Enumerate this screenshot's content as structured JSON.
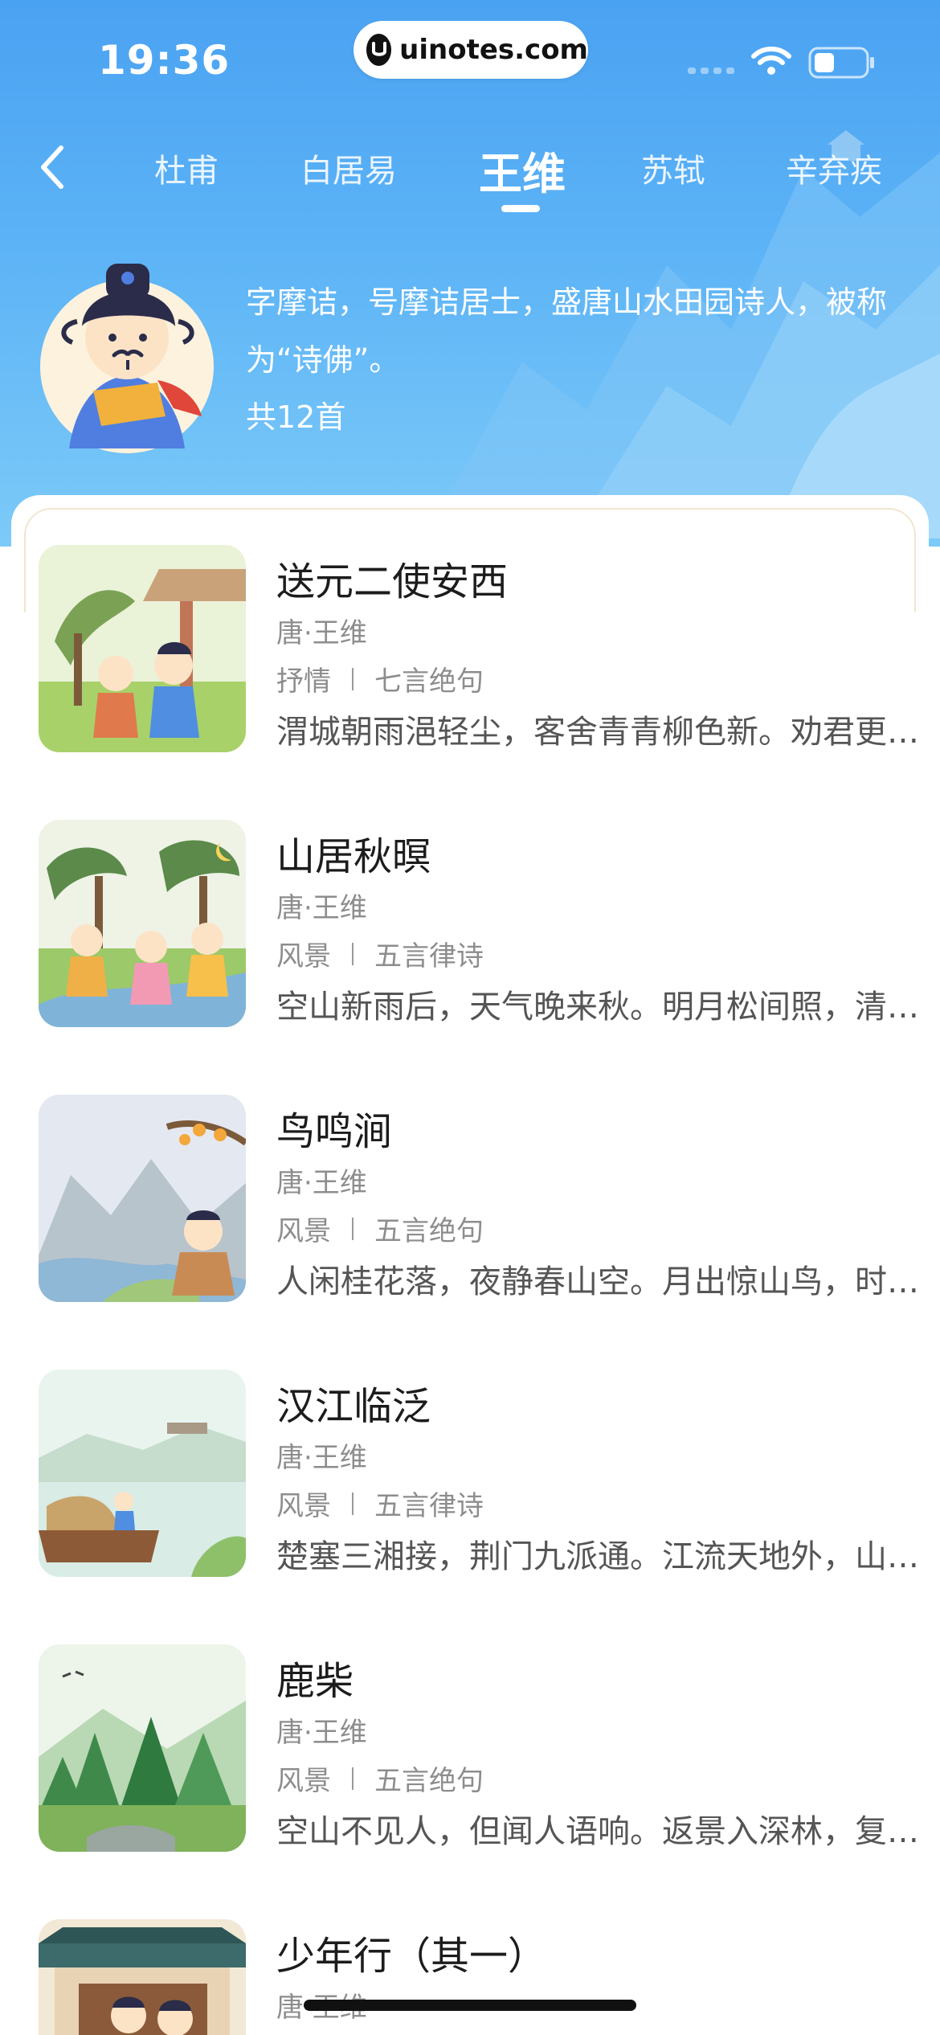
{
  "status_bar": {
    "time": "19:36",
    "site": "uinotes.com"
  },
  "tabs": [
    {
      "label": "杜甫",
      "active": false
    },
    {
      "label": "白居易",
      "active": false
    },
    {
      "label": "王维",
      "active": true
    },
    {
      "label": "苏轼",
      "active": false
    },
    {
      "label": "辛弃疾",
      "active": false
    }
  ],
  "author": {
    "description": "字摩诘，号摩诘居士，盛唐山水田园诗人，被称为“诗佛”。",
    "count": "共12首"
  },
  "poems": [
    {
      "title": "送元二使安西",
      "author": "唐·王维",
      "theme": "抒情",
      "form": "七言绝句",
      "excerpt": "渭城朝雨浥轻尘，客舍青青柳色新。劝君更尽一杯酒，西出阳关无故人。"
    },
    {
      "title": "山居秋暝",
      "author": "唐·王维",
      "theme": "风景",
      "form": "五言律诗",
      "excerpt": "空山新雨后，天气晚来秋。明月松间照，清泉石上流。"
    },
    {
      "title": "鸟鸣涧",
      "author": "唐·王维",
      "theme": "风景",
      "form": "五言绝句",
      "excerpt": "人闲桂花落，夜静春山空。月出惊山鸟，时鸣春涧中。"
    },
    {
      "title": "汉江临泛",
      "author": "唐·王维",
      "theme": "风景",
      "form": "五言律诗",
      "excerpt": "楚塞三湘接，荆门九派通。江流天地外，山色有无中。"
    },
    {
      "title": "鹿柴",
      "author": "唐·王维",
      "theme": "风景",
      "form": "五言绝句",
      "excerpt": "空山不见人，但闻人语响。返景入深林，复照青苔上。"
    },
    {
      "title": "少年行（其一）",
      "author": "唐·王维"
    }
  ],
  "colors": {
    "header_top": "#4aa2f2",
    "header_bottom": "#7ccaf8",
    "title_text": "#1c1c1c",
    "meta_text": "#8d8d8d"
  }
}
